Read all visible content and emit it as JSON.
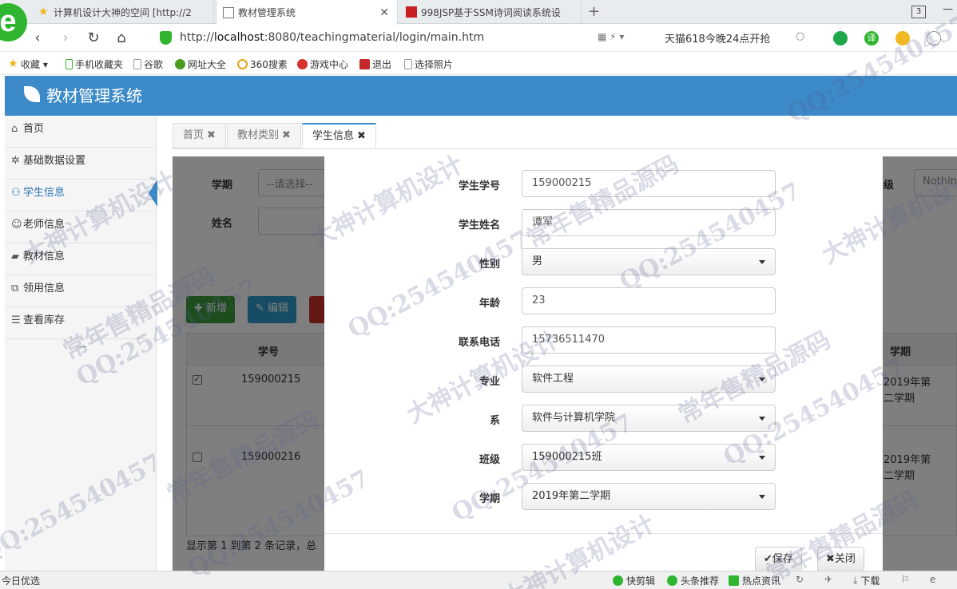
{
  "browser": {
    "tabs": [
      {
        "title": "计算机设计大神的空间 [http://2"
      },
      {
        "title": "教材管理系统"
      },
      {
        "title": "998JSP基于SSM诗词阅读系统设"
      }
    ],
    "new_tab": "+",
    "tab_count": "3",
    "url_prefix": "http://",
    "url_host": "localhost",
    "url_rest": ":8080/teachingmaterial/login/main.htm",
    "promo": "天猫618今晚24点开抢",
    "translate": "译",
    "bookmarks": [
      {
        "label": "收藏"
      },
      {
        "label": "手机收藏夹"
      },
      {
        "label": "谷歌"
      },
      {
        "label": "网址大全"
      },
      {
        "label": "360搜素"
      },
      {
        "label": "游戏中心"
      },
      {
        "label": "退出"
      },
      {
        "label": "选择照片"
      }
    ]
  },
  "app": {
    "title": "教材管理系统",
    "sidebar": [
      {
        "label": "首页",
        "icon": "home-icon"
      },
      {
        "label": "基础数据设置",
        "icon": "gear-icon"
      },
      {
        "label": "学生信息",
        "icon": "users-icon"
      },
      {
        "label": "老师信息",
        "icon": "user-icon"
      },
      {
        "label": "教材信息",
        "icon": "book-icon"
      },
      {
        "label": "领用信息",
        "icon": "clone-icon"
      },
      {
        "label": "查看库存",
        "icon": "list-icon"
      }
    ],
    "sidebar_more": "—",
    "content_tabs": [
      {
        "label": "首页"
      },
      {
        "label": "教材类别"
      },
      {
        "label": "学生信息"
      }
    ],
    "close_glyph": "✖",
    "search": {
      "term_label": "学期",
      "term_placeholder": "--请选择--",
      "name_label": "姓名",
      "class_label_partial": "级",
      "class_value_partial": "Nothin"
    },
    "toolbar": {
      "add_label": "新增",
      "edit_label": "编辑"
    },
    "table": {
      "headers": {
        "student_no": "学号",
        "term": "学期"
      },
      "rows": [
        {
          "student_no": "159000215",
          "term_line1": "2019年第",
          "term_line2": "二学期",
          "checked": true
        },
        {
          "student_no": "159000216",
          "term_line1": "2019年第",
          "term_line2": "二学期",
          "checked": false
        }
      ]
    },
    "pager_text": "显示第 1 到第 2 条记录，总"
  },
  "modal": {
    "fields": [
      {
        "label": "学生学号",
        "value": "159000215",
        "type": "input"
      },
      {
        "label": "学生姓名",
        "value": "谭军",
        "type": "input"
      },
      {
        "label": "性别",
        "value": "男",
        "type": "select"
      },
      {
        "label": "年龄",
        "value": "23",
        "type": "input"
      },
      {
        "label": "联系电话",
        "value": "15736511470",
        "type": "input"
      },
      {
        "label": "专业",
        "value": "软件工程",
        "type": "select"
      },
      {
        "label": "系",
        "value": "软件与计算机学院",
        "type": "select"
      },
      {
        "label": "班级",
        "value": "159000215班",
        "type": "select"
      },
      {
        "label": "学期",
        "value": "2019年第二学期",
        "type": "select"
      }
    ],
    "save_label": "保存",
    "close_label": "关闭"
  },
  "statusbar": {
    "left": "今日优选",
    "items": [
      {
        "label": "快剪辑"
      },
      {
        "label": "头条推荐"
      },
      {
        "label": "热点资讯"
      },
      {
        "label": "下载"
      }
    ]
  },
  "watermark": {
    "lines": [
      "QQ:254540457",
      "大神计算机设计",
      "常年售精品源码"
    ]
  }
}
